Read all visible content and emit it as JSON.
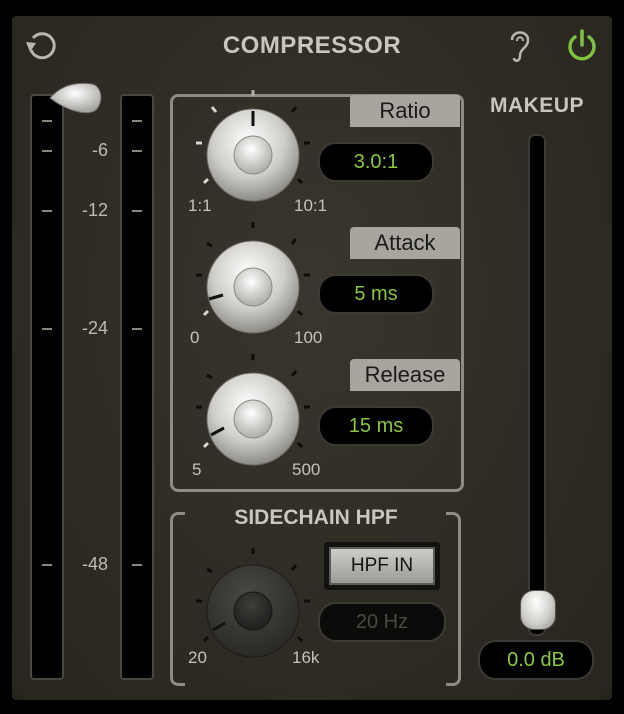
{
  "header": {
    "title": "COMPRESSOR",
    "reset_icon": "reset-icon",
    "listen_icon": "ear-icon",
    "power_icon": "power-icon",
    "power_color": "#7fc242"
  },
  "meter": {
    "scale": [
      "-6",
      "-12",
      "-24",
      "-48"
    ]
  },
  "controls": {
    "ratio": {
      "label": "Ratio",
      "value": "3.0:1",
      "min": "1:1",
      "max": "10:1"
    },
    "attack": {
      "label": "Attack",
      "value": "5 ms",
      "min": "0",
      "max": "100"
    },
    "release": {
      "label": "Release",
      "value": "15 ms",
      "min": "5",
      "max": "500"
    }
  },
  "sidechain": {
    "title": "SIDECHAIN HPF",
    "hpf_button": "HPF IN",
    "value": "20 Hz",
    "min": "20",
    "max": "16k"
  },
  "makeup": {
    "title": "MAKEUP",
    "value": "0.0 dB"
  },
  "colors": {
    "accent_green": "#8bc63f",
    "panel": "#2e2b24"
  }
}
